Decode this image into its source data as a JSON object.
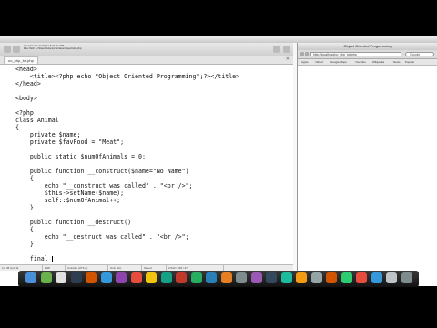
{
  "editor": {
    "info_lines": [
      "Last Saved: 11/10/11 5:31:01 PM",
      "File Path: ~/Sites/htdocs/ch/class/object/obj.php"
    ],
    "tab_label": "oo_php_tut.php",
    "code": [
      "<head>",
      "    <title><?php echo \"Object Oriented Programming\";?></title>",
      "</head>",
      "",
      "<body>",
      "",
      "<?php",
      "class Animal",
      "{",
      "    private $name;",
      "    private $favFood = \"Meat\";",
      "",
      "    public static $numOfAnimals = 0;",
      "",
      "    public function __construct($name=\"No Name\")",
      "    {",
      "        echo \"__construct was called\" . \"<br />\";",
      "        $this->setName($name);",
      "        self::$numOfAnimal++;",
      "    }",
      "",
      "    public function __destruct()",
      "    {",
      "        echo \"__destruct was called\" . \"<br />\";",
      "    }",
      "",
      "    final "
    ],
    "status": [
      "Ln: 36 Col: 11",
      "PHP",
      "Unicode (UTF-8)",
      "Unix (LF)",
      "Saved",
      "2,543 / 318 / 47"
    ]
  },
  "browser": {
    "title": "Object Oriented Programming",
    "url": "http://localhost/oo_php_tut.php",
    "search_placeholder": "Google",
    "bookmarks": [
      "Apple",
      "Yahoo!",
      "Google Maps",
      "YouTube",
      "Wikipedia",
      "News",
      "Popular"
    ]
  },
  "dock": {
    "icon_colors": [
      "#4a90d9",
      "#6ab04c",
      "#e1e1e1",
      "#2c3e50",
      "#d35400",
      "#3498db",
      "#8e44ad",
      "#e74c3c",
      "#f1c40f",
      "#16a085",
      "#c0392b",
      "#27ae60",
      "#2980b9",
      "#e67e22",
      "#7f8c8d",
      "#9b59b6",
      "#34495e",
      "#1abc9c",
      "#f39c12",
      "#95a5a6",
      "#d35400",
      "#2ecc71",
      "#e74c3c",
      "#3498db",
      "#bdc3c7",
      "#7f8c8d"
    ]
  }
}
